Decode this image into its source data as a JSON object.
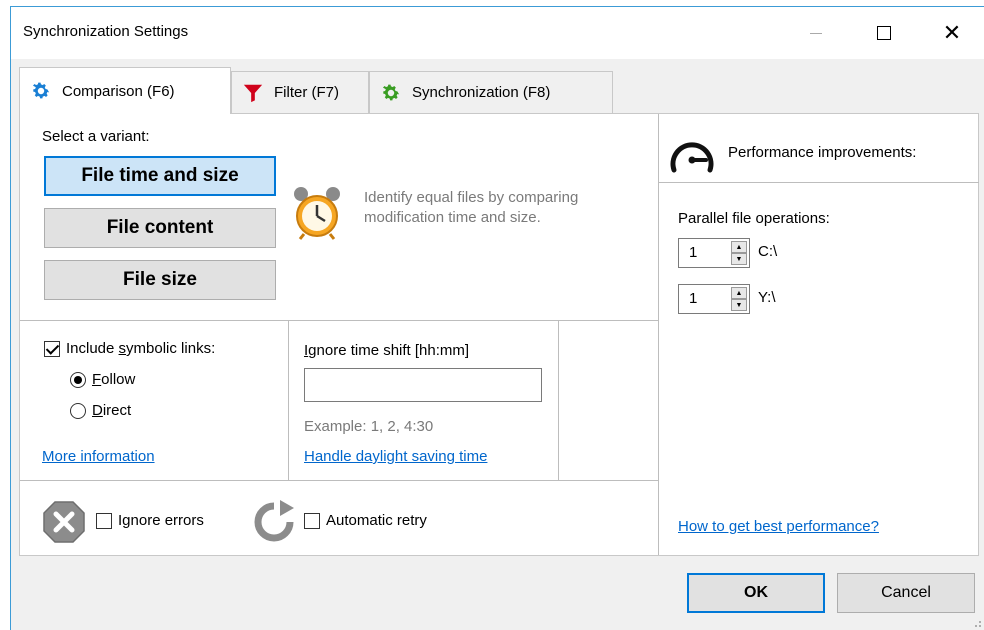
{
  "window": {
    "title": "Synchronization Settings"
  },
  "tabs": [
    {
      "label": "Comparison (F6)",
      "icon": "gear-icon"
    },
    {
      "label": "Filter (F7)",
      "icon": "funnel-icon"
    },
    {
      "label": "Synchronization (F8)",
      "icon": "gear-icon"
    }
  ],
  "comparison": {
    "select_label": "Select a variant:",
    "variants": [
      "File time and size",
      "File content",
      "File size"
    ],
    "description_line1": "Identify equal files by comparing",
    "description_line2": "modification time and size."
  },
  "symlinks": {
    "label_prefix": "Include ",
    "label_mnemonic": "s",
    "label_suffix": "ymbolic links:",
    "follow_mnemonic": "F",
    "follow_rest": "ollow",
    "direct_mnemonic": "D",
    "direct_rest": "irect",
    "more_info": "More information"
  },
  "timeshift": {
    "label_mnemonic": "I",
    "label_rest": "gnore time shift [hh:mm]",
    "value": "",
    "example": "Example:  1, 2, 4:30",
    "dst_link": "Handle daylight saving time"
  },
  "errors": {
    "ignore_label": "Ignore errors",
    "retry_label": "Automatic retry"
  },
  "performance": {
    "title": "Performance improvements:",
    "parallel_label": "Parallel file operations:",
    "drives": [
      {
        "value": "1",
        "drive": "C:\\"
      },
      {
        "value": "1",
        "drive": "Y:\\"
      }
    ],
    "help_link": "How to get best performance?"
  },
  "buttons": {
    "ok": "OK",
    "cancel": "Cancel"
  },
  "colors": {
    "accent": "#0078d7",
    "link": "#0066cc",
    "window_border": "#3c9bd6"
  }
}
